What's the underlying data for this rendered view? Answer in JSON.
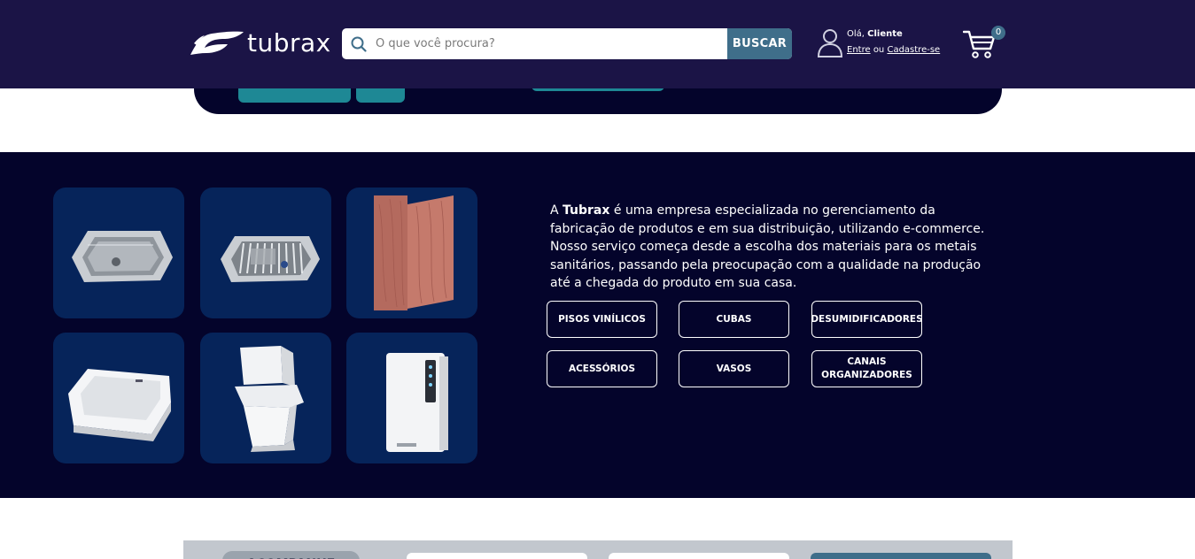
{
  "header": {
    "logo_text": "tubrax",
    "search": {
      "placeholder": "O que você procura?",
      "button_label": "BUSCAR"
    },
    "user": {
      "greeting": "Olá,",
      "name": "Cliente",
      "login_label": "Entre",
      "or_label": "ou",
      "register_label": "Cadastre-se"
    },
    "cart": {
      "count": "0"
    }
  },
  "about": {
    "text_prefix": "A",
    "brand": "Tubrax",
    "text_body": "é uma empresa especializada no gerenciamento da fabricação de produtos e em sua distribuição, utilizando e-commerce. Nosso serviço começa desde a escolha dos materiais para os metais sanitários, passando pela preocupação com a qualidade na produção até a chegada do produto em sua casa.",
    "categories": [
      {
        "label": "PISOS VINÍLICOS"
      },
      {
        "label": "CUBAS"
      },
      {
        "label": "DESUMIDIFICADORES"
      },
      {
        "label": "ACESSÓRIOS"
      },
      {
        "label": "VASOS"
      },
      {
        "label": "CANAIS ORGANIZADORES"
      }
    ],
    "products": [
      {
        "icon": "steel-sink-icon"
      },
      {
        "icon": "sink-with-drainer-icon"
      },
      {
        "icon": "vinyl-floor-planks-icon"
      },
      {
        "icon": "ceramic-basin-icon"
      },
      {
        "icon": "toilet-icon"
      },
      {
        "icon": "dehumidifier-icon"
      }
    ]
  },
  "bottom": {
    "heading": "ACOMPANHE"
  },
  "colors": {
    "header_bg": "#1b1446",
    "section_bg": "#04042b",
    "tile_bg": "#06245a",
    "accent": "#3f6e8a",
    "teal": "#1e8895"
  }
}
